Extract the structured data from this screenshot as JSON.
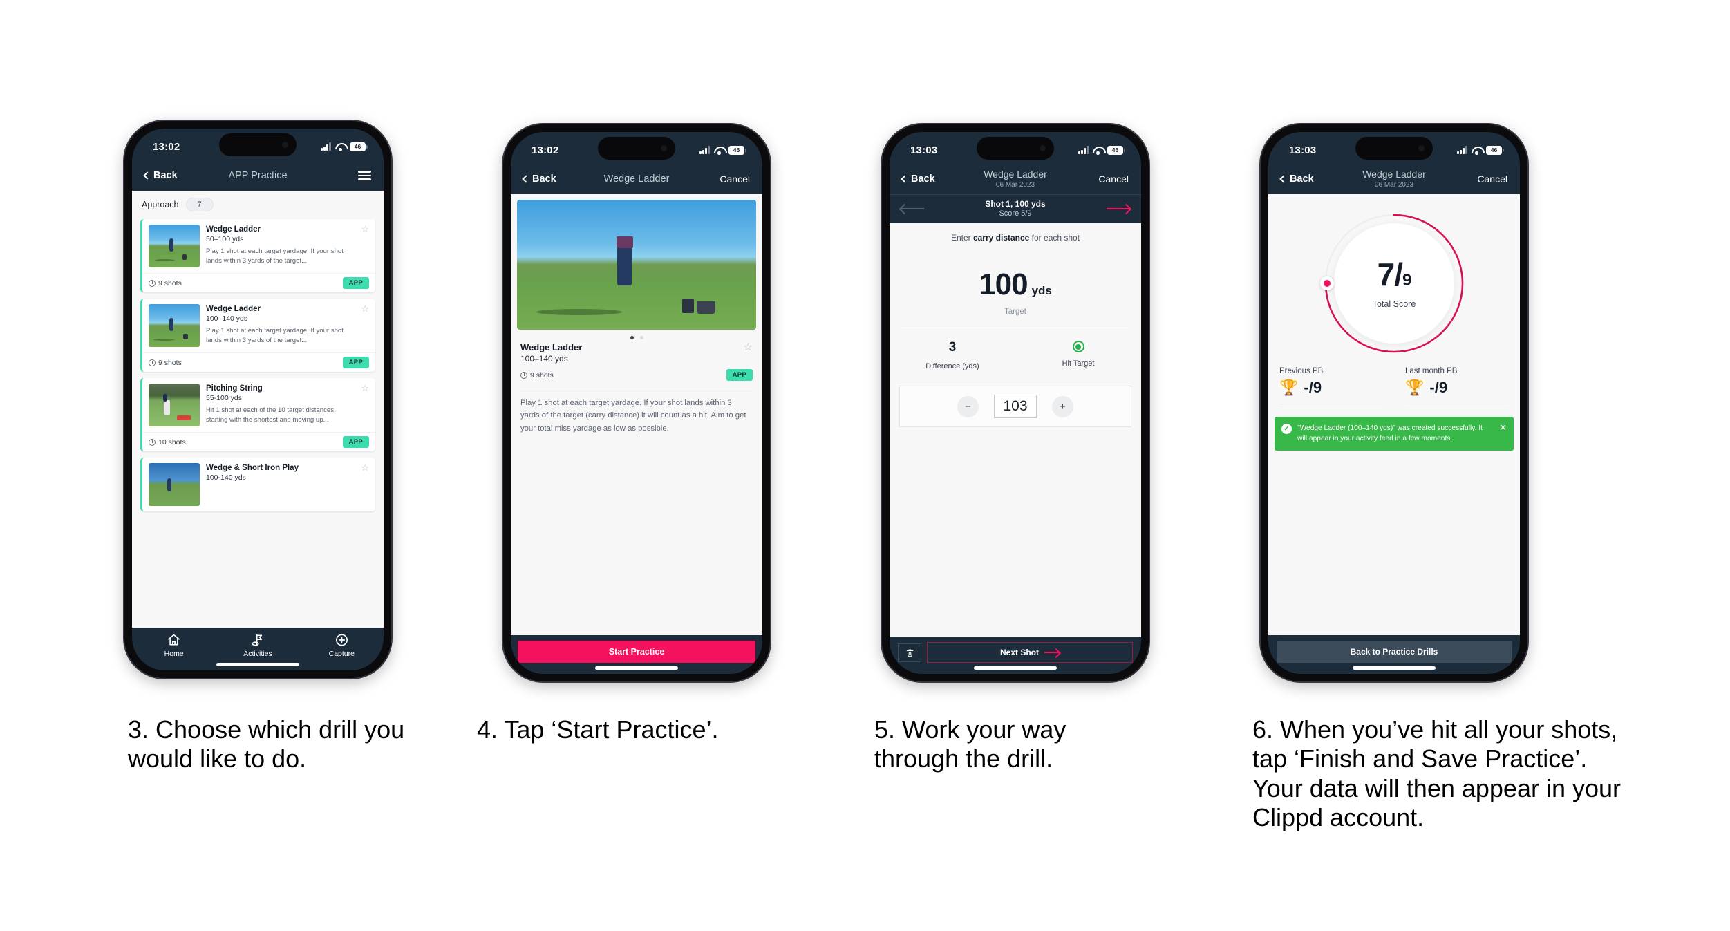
{
  "phones": [
    {
      "id": "phone-1",
      "statusbar": {
        "time": "13:02",
        "battery": "46"
      },
      "navbar": {
        "back": "Back",
        "title": "APP Practice",
        "menu_icon": "hamburger-icon"
      },
      "filter": {
        "label": "Approach",
        "count": "7"
      },
      "cards": [
        {
          "title": "Wedge Ladder",
          "yardage": "50–100 yds",
          "description": "Play 1 shot at each target yardage. If your shot lands within 3 yards of the target...",
          "shots": "9 shots",
          "badge": "APP"
        },
        {
          "title": "Wedge Ladder",
          "yardage": "100–140 yds",
          "description": "Play 1 shot at each target yardage. If your shot lands within 3 yards of the target...",
          "shots": "9 shots",
          "badge": "APP"
        },
        {
          "title": "Pitching String",
          "yardage": "55-100 yds",
          "description": "Hit 1 shot at each of the 10 target distances, starting with the shortest and moving up...",
          "shots": "10 shots",
          "badge": "APP"
        },
        {
          "title": "Wedge & Short Iron Play",
          "yardage": "100-140 yds",
          "description": "",
          "shots": "",
          "badge": ""
        }
      ],
      "tabs": [
        {
          "label": "Home",
          "icon": "home-icon"
        },
        {
          "label": "Activities",
          "icon": "golf-flag-icon"
        },
        {
          "label": "Capture",
          "icon": "plus-circle-icon"
        }
      ]
    },
    {
      "id": "phone-2",
      "statusbar": {
        "time": "13:02",
        "battery": "46"
      },
      "navbar": {
        "back": "Back",
        "title": "Wedge Ladder",
        "right": "Cancel"
      },
      "detail": {
        "title": "Wedge Ladder",
        "yardage": "100–140 yds",
        "shots": "9 shots",
        "badge": "APP",
        "description": "Play 1 shot at each target yardage. If your shot lands within 3 yards of the target (carry distance) it will count as a hit. Aim to get your total miss yardage as low as possible."
      },
      "cta": "Start Practice"
    },
    {
      "id": "phone-3",
      "statusbar": {
        "time": "13:03",
        "battery": "46"
      },
      "navbar": {
        "back": "Back",
        "title": "Wedge Ladder",
        "subtitle": "06 Mar 2023",
        "right": "Cancel"
      },
      "shotbar": {
        "shot": "Shot 1, 100 yds",
        "score": "Score 5/9"
      },
      "hint_prefix": "Enter ",
      "hint_bold": "carry distance",
      "hint_suffix": " for each shot",
      "target": {
        "value": "100",
        "unit": "yds",
        "caption": "Target"
      },
      "stats": [
        {
          "value": "3",
          "label": "Difference (yds)"
        },
        {
          "value": "",
          "label": "Hit Target",
          "icon": "target-hit-icon"
        }
      ],
      "stepper": {
        "minus": "−",
        "value": "103",
        "plus": "+"
      },
      "footer": {
        "delete_icon": "trash-icon",
        "next": "Next Shot"
      }
    },
    {
      "id": "phone-4",
      "statusbar": {
        "time": "13:03",
        "battery": "46"
      },
      "navbar": {
        "back": "Back",
        "title": "Wedge Ladder",
        "subtitle": "06 Mar 2023",
        "right": "Cancel"
      },
      "gauge": {
        "score": "7",
        "separator": "/",
        "denominator": "9",
        "caption": "Total Score"
      },
      "pbs": [
        {
          "label": "Previous PB",
          "icon": "trophy-icon",
          "value": "-/9"
        },
        {
          "label": "Last month PB",
          "icon": "trophy-icon",
          "value": "-/9"
        }
      ],
      "toast": {
        "icon": "check-circle-icon",
        "message": "\"Wedge Ladder (100–140 yds)\" was created successfully. It will appear in your activity feed in a few moments.",
        "close_icon": "close-icon"
      },
      "footer_button": "Back to Practice Drills"
    }
  ],
  "captions": [
    "3. Choose which drill you would like to do.",
    "4. Tap ‘Start Practice’.",
    "5. Work your way through the drill.",
    "6. When you’ve hit all your shots, tap ‘Finish and Save Practice’. Your data will then appear in your Clippd account."
  ],
  "colors": {
    "nav_dark": "#1c2c3b",
    "accent_pink": "#f4115e",
    "accent_teal": "#3ddcae",
    "toast_green": "#38b848",
    "hit_green": "#22b34b"
  }
}
